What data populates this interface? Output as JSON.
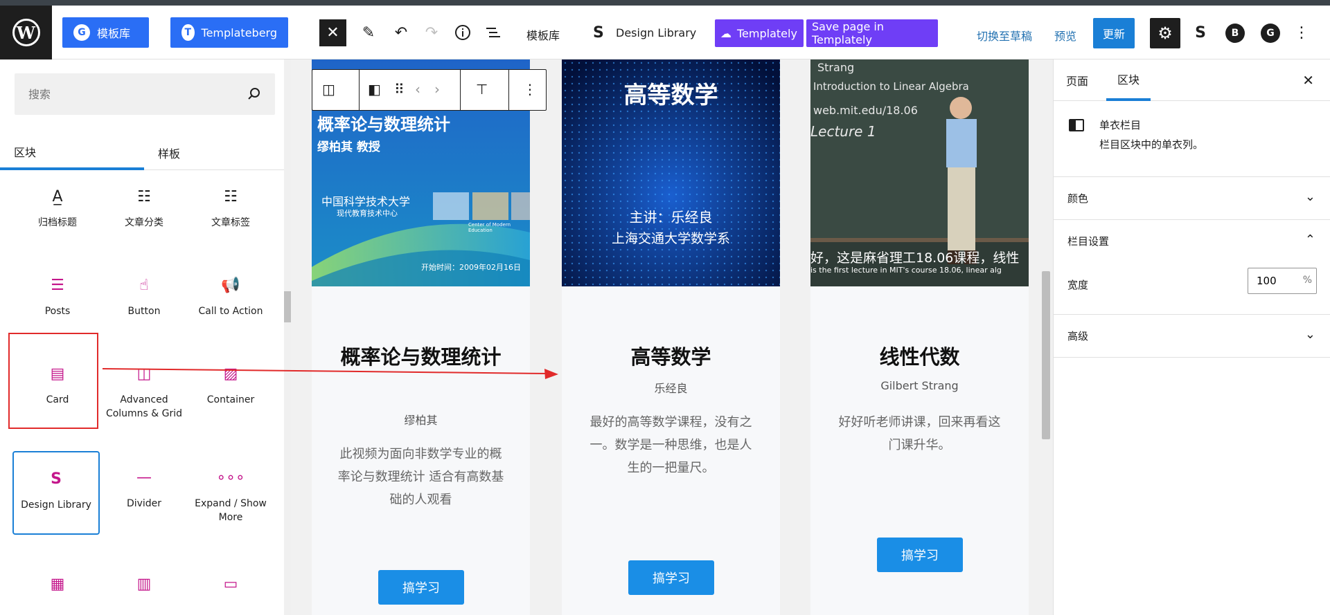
{
  "topbar": {
    "template_lib_btn": "模板库",
    "templateberg_btn": "Templateberg",
    "template_lib_text": "模板库",
    "design_library": "Design Library",
    "templately_btn": "Templately",
    "save_templately_btn": "Save page in Templately",
    "switch_draft": "切换至草稿",
    "preview": "预览",
    "update": "更新"
  },
  "inserter": {
    "search_placeholder": "搜索",
    "tabs": [
      "区块",
      "样板"
    ],
    "blocks": [
      {
        "label": "归档标题",
        "icon": "archive-title-icon"
      },
      {
        "label": "文章分类",
        "icon": "categories-icon"
      },
      {
        "label": "文章标签",
        "icon": "tags-icon"
      },
      {
        "label": "Posts",
        "icon": "posts-icon"
      },
      {
        "label": "Button",
        "icon": "button-icon"
      },
      {
        "label": "Call to Action",
        "icon": "megaphone-icon"
      },
      {
        "label": "Card",
        "icon": "card-icon"
      },
      {
        "label": "Advanced Columns & Grid",
        "icon": "columns-icon"
      },
      {
        "label": "Container",
        "icon": "container-icon"
      },
      {
        "label": "Design Library",
        "icon": "stackable-icon"
      },
      {
        "label": "Divider",
        "icon": "divider-icon"
      },
      {
        "label": "Expand / Show More",
        "icon": "ellipsis-icon"
      }
    ]
  },
  "canvas": {
    "columns": [
      {
        "img_title": "概率论与数理统计",
        "img_sub": "缪柏其 教授",
        "img_school": "中国科学技术大学",
        "img_center": "现代教育技术中心",
        "img_center_en": "Center of Modern Education",
        "img_date": "开始时间：2009年02月16日",
        "title": "概率论与数理统计",
        "author": "缪柏其",
        "desc": "此视频为面向非数学专业的概率论与数理统计 适合有高数基础的人观看",
        "button": "搞学习"
      },
      {
        "img_title": "高等数学",
        "img_sub1": "主讲：乐经良",
        "img_sub2": "上海交通大学数学系",
        "title": "高等数学",
        "author": "乐经良",
        "desc": "最好的高等数学课程，没有之一。数学是一种思维，也是人生的一把量尺。",
        "button": "搞学习"
      },
      {
        "img_board1": "Strang",
        "img_board2": "Introduction to Linear Algebra",
        "img_board3": "web.mit.edu/18.06",
        "img_board4": "Lecture 1",
        "img_caption_cn": "好，这是麻省理工18.06课程，线性",
        "img_caption_en": "is the first lecture in MIT's course 18.06, linear alg",
        "title": "线性代数",
        "author": "Gilbert Strang",
        "desc": "好好听老师讲课，回来再看这门课升华。",
        "button": "搞学习"
      }
    ]
  },
  "settings": {
    "tabs": [
      "页面",
      "区块"
    ],
    "block_name": "单衣栏目",
    "block_desc": "栏目区块中的单衣列。",
    "color": "颜色",
    "column_settings": "栏目设置",
    "width_label": "宽度",
    "width_value": "100",
    "width_unit": "%",
    "advanced": "高级"
  },
  "colors": {
    "accent": "#1a7fd6",
    "wp_blue": "#2a6ef5",
    "templately_purple": "#6f3ef6",
    "block_icon_pink": "#c4168b",
    "annotation_red": "#e12a2a"
  }
}
